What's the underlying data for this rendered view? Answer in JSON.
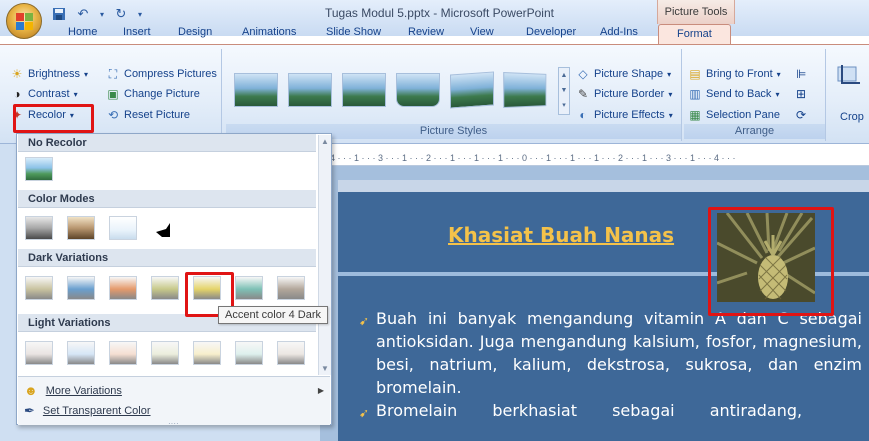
{
  "window": {
    "title": "Tugas Modul 5.pptx - Microsoft PowerPoint",
    "context_tools": "Picture Tools"
  },
  "tabs": [
    {
      "label": "Home"
    },
    {
      "label": "Insert"
    },
    {
      "label": "Design"
    },
    {
      "label": "Animations"
    },
    {
      "label": "Slide Show"
    },
    {
      "label": "Review"
    },
    {
      "label": "View"
    },
    {
      "label": "Developer"
    },
    {
      "label": "Add-Ins"
    },
    {
      "label": "Format",
      "active": true
    }
  ],
  "ribbon": {
    "adjust": {
      "brightness": "Brightness",
      "contrast": "Contrast",
      "recolor": "Recolor",
      "compress": "Compress Pictures",
      "change": "Change Picture",
      "reset": "Reset Picture"
    },
    "picture_styles": {
      "label": "Picture Styles",
      "shape": "Picture Shape",
      "border": "Picture Border",
      "effects": "Picture Effects"
    },
    "arrange": {
      "label": "Arrange",
      "bring_front": "Bring to Front",
      "send_back": "Send to Back",
      "selection_pane": "Selection Pane"
    },
    "size": {
      "crop": "Crop"
    }
  },
  "ruler": {
    "text": "4 · · · 1 · · · 3 · · · 1 · · · 2 · · · 1 · · · 1 · · · 1 · · · 0 · · · 1 · · · 1 · · · 1 · · · 2 · · · 1 · · · 3 · · · 1 · · · 4 · · ·"
  },
  "slide": {
    "title": "Khasiat Buah Nanas",
    "para1": "Buah ini banyak mengandung vitamin A dan C sebagai antioksidan. Juga mengandung kalsium, fosfor, magnesium, besi, natrium, kalium, dekstrosa, sukrosa, dan enzim bromelain.",
    "para2": "Bromelain berkhasiat sebagai antiradang,"
  },
  "recolor_menu": {
    "no_recolor": "No Recolor",
    "color_modes": "Color Modes",
    "dark_variations": "Dark Variations",
    "light_variations": "Light Variations",
    "more_variations": "More Variations",
    "set_transparent": "Set Transparent Color",
    "tooltip": "Accent color 4 Dark",
    "colors": {
      "dark": [
        "#c9c3a0",
        "#6a9fcf",
        "#e59a6c",
        "#c7c98a",
        "#e5d46a",
        "#7ec1b6",
        "#b3a79b"
      ],
      "light": [
        "#e9e4e2",
        "#d6e6f6",
        "#f5dfd2",
        "#eceedd",
        "#f7efcc",
        "#def0ed",
        "#ece7e3"
      ]
    }
  },
  "colors": {
    "highlight": "#e01414",
    "slide_bg": "#3e6898",
    "title_gold": "#f4c24a"
  }
}
